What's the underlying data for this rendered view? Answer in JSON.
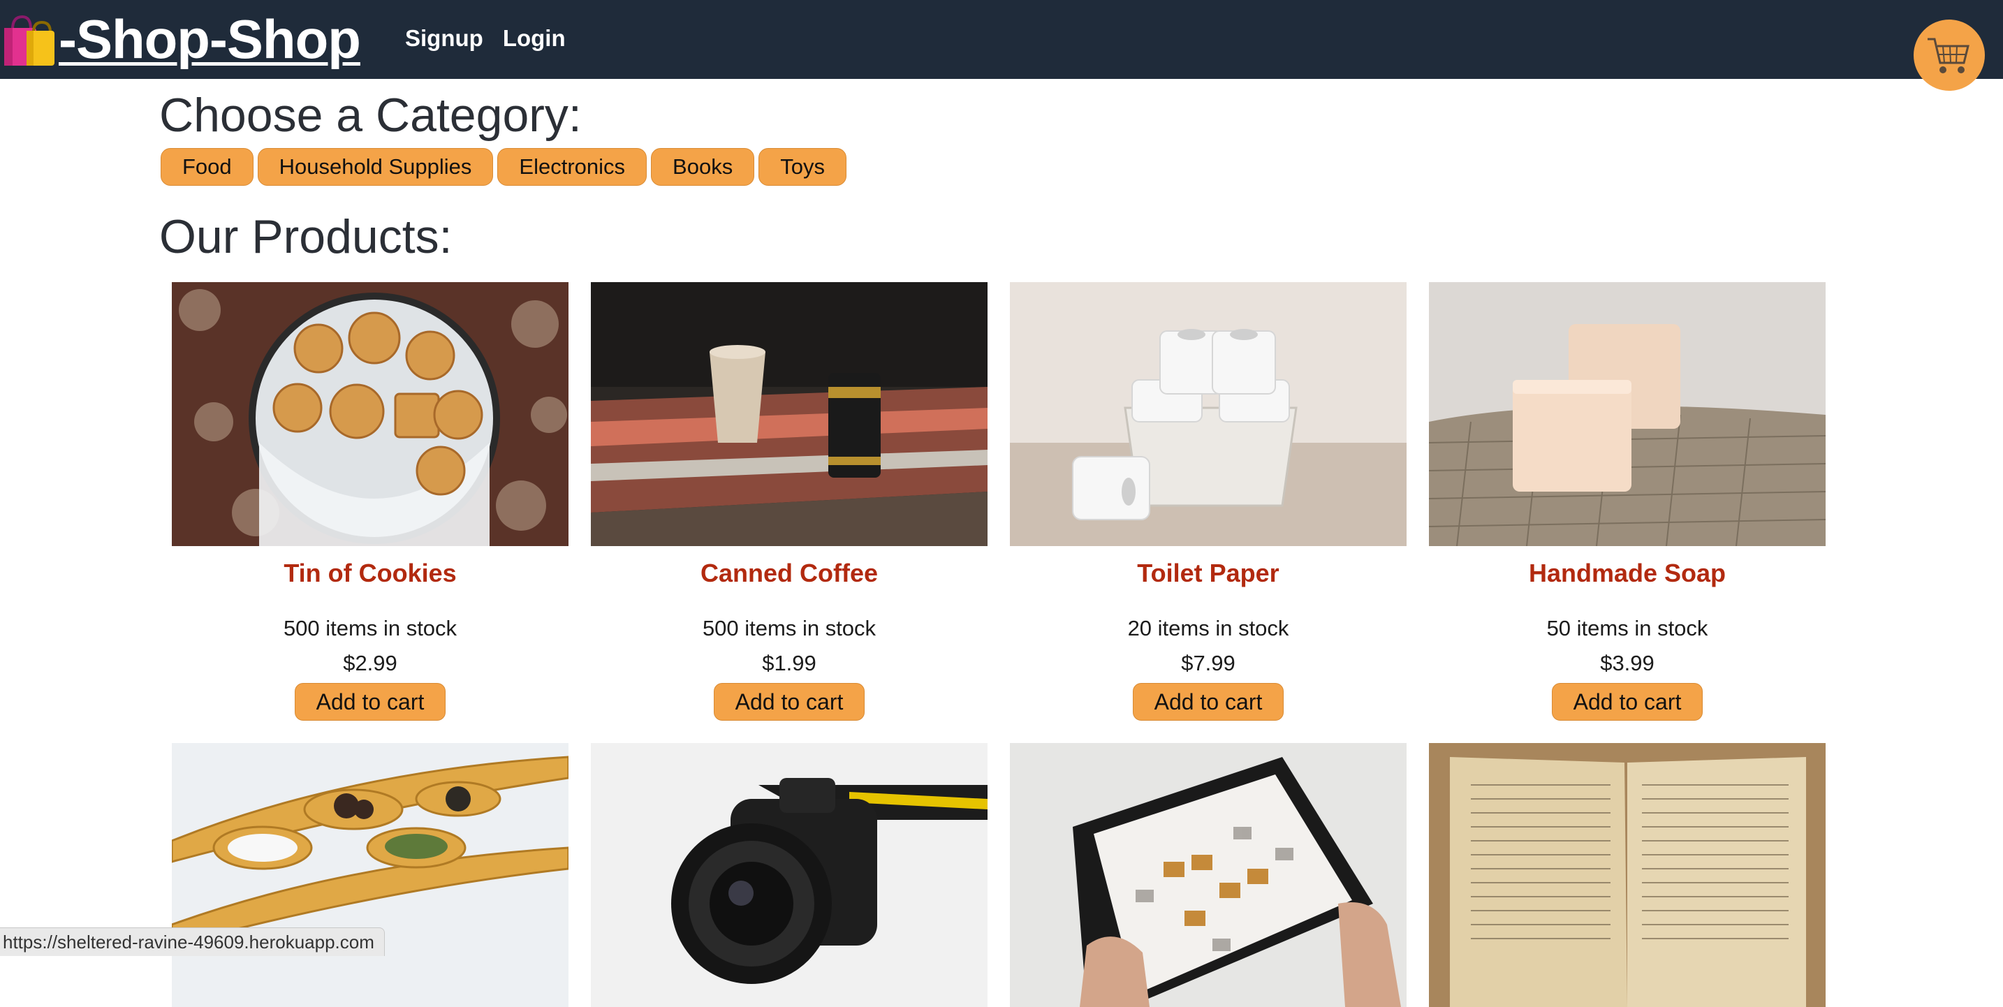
{
  "header": {
    "brand": "-Shop-Shop",
    "nav": [
      "Signup",
      "Login"
    ],
    "cart_icon": "shopping-cart-icon"
  },
  "categories": {
    "title": "Choose a Category:",
    "items": [
      "Food",
      "Household Supplies",
      "Electronics",
      "Books",
      "Toys"
    ]
  },
  "products": {
    "title": "Our Products:",
    "add_label": "Add to cart",
    "items": [
      {
        "name": "Tin of Cookies",
        "stock": "500 items in stock",
        "price": "$2.99",
        "image": "cookies-photo"
      },
      {
        "name": "Canned Coffee",
        "stock": "500 items in stock",
        "price": "$1.99",
        "image": "coffee-photo"
      },
      {
        "name": "Toilet Paper",
        "stock": "20 items in stock",
        "price": "$7.99",
        "image": "toilet-paper-photo"
      },
      {
        "name": "Handmade Soap",
        "stock": "50 items in stock",
        "price": "$3.99",
        "image": "soap-photo"
      },
      {
        "image": "spoons-photo"
      },
      {
        "image": "camera-photo"
      },
      {
        "image": "tablet-photo"
      },
      {
        "image": "book-photo"
      }
    ]
  },
  "status_url": "https://sheltered-ravine-49609.herokuapp.com",
  "colors": {
    "header_bg": "#1f2b3a",
    "accent": "#f4a348",
    "product_name": "#b22a0f"
  }
}
